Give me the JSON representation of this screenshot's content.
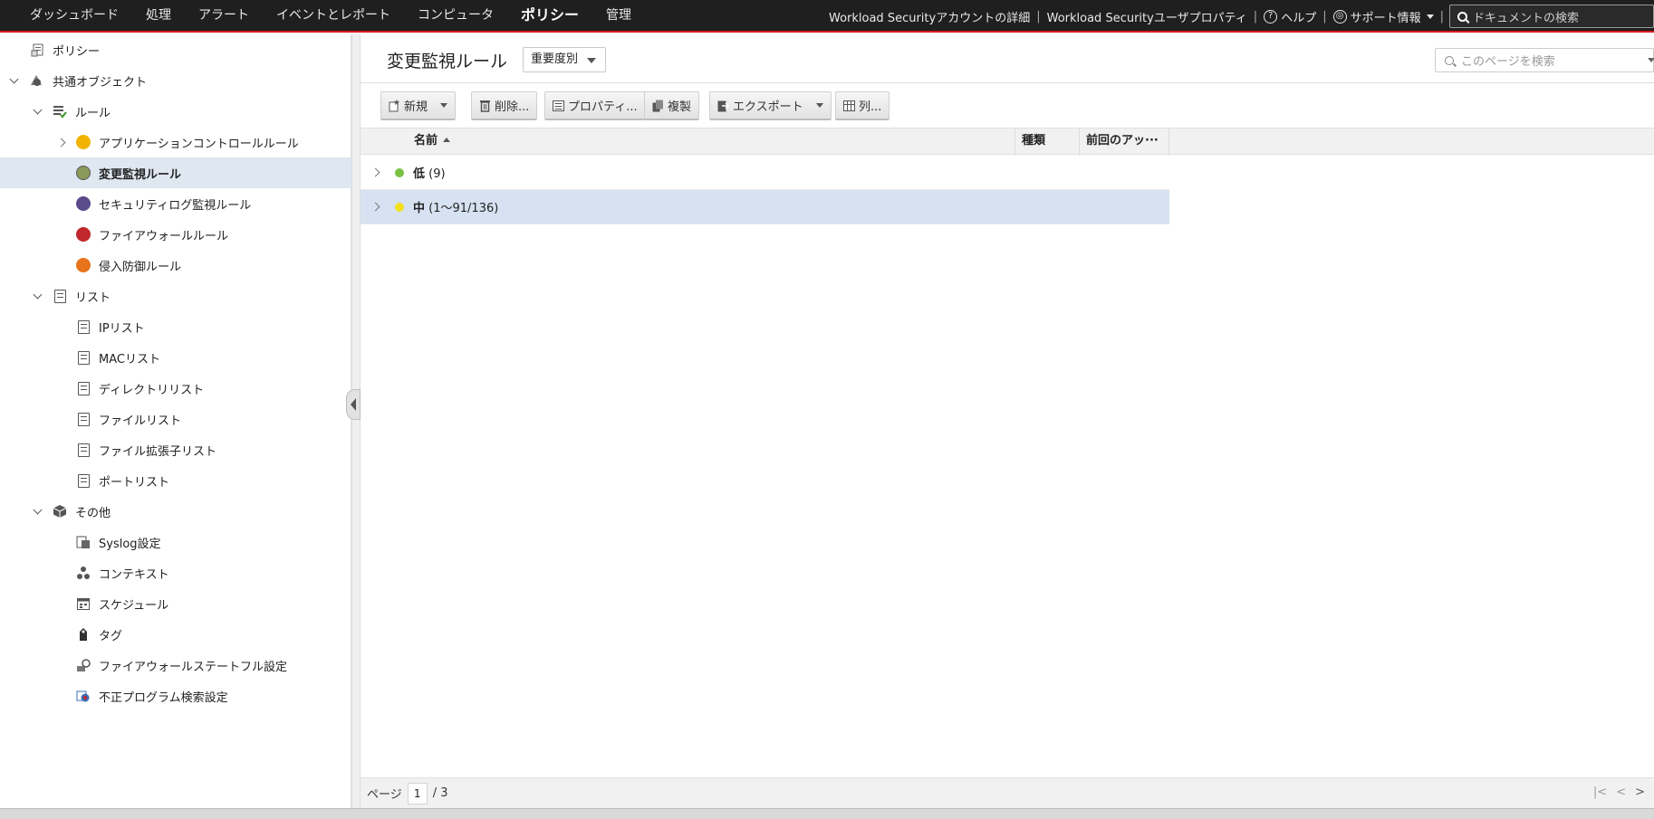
{
  "topnav": {
    "items": [
      "ダッシュボード",
      "処理",
      "アラート",
      "イベントとレポート",
      "コンピュータ",
      "ポリシー",
      "管理"
    ],
    "active_index": 5,
    "account_details": "Workload Securityアカウントの詳細",
    "user_properties": "Workload Securityユーザプロパティ",
    "help": "ヘルプ",
    "support": "サポート情報",
    "search_placeholder": "ドキュメントの検索",
    "separator": "|"
  },
  "sidebar": {
    "policies": "ポリシー",
    "common_objects": "共通オブジェクト",
    "rules": "ルール",
    "app_control_rules": "アプリケーションコントロールルール",
    "integrity_rules": "変更監視ルール",
    "log_inspection_rules": "セキュリティログ監視ルール",
    "firewall_rules": "ファイアウォールルール",
    "ips_rules": "侵入防御ルール",
    "lists": "リスト",
    "ip_list": "IPリスト",
    "mac_list": "MACリスト",
    "directory_list": "ディレクトリリスト",
    "file_list": "ファイルリスト",
    "file_ext_list": "ファイル拡張子リスト",
    "port_list": "ポートリスト",
    "other": "その他",
    "syslog": "Syslog設定",
    "contexts": "コンテキスト",
    "schedules": "スケジュール",
    "tags": "タグ",
    "stateful": "ファイアウォールステートフル設定",
    "malware_scan": "不正プログラム検索設定"
  },
  "main": {
    "title": "変更監視ルール",
    "group_by": "重要度別",
    "search_placeholder": "このページを検索",
    "toolbar": {
      "new": "新規",
      "delete": "削除...",
      "properties": "プロパティ...",
      "duplicate": "複製",
      "export": "エクスポート",
      "columns": "列..."
    },
    "columns": [
      "名前",
      "種類",
      "前回のアッ···"
    ],
    "groups": [
      {
        "name": "低",
        "count": "(9)",
        "color": "#7ac143"
      },
      {
        "name": "中",
        "count": "(1～91/136)",
        "color": "#f2e21b"
      }
    ],
    "footer": {
      "page_label": "ページ",
      "page": "1",
      "total": "/ 3"
    }
  },
  "colors": {
    "topbar_bg": "#1f1f1f",
    "accent_red": "#d71920",
    "selected_row": "#dfe7f1"
  }
}
